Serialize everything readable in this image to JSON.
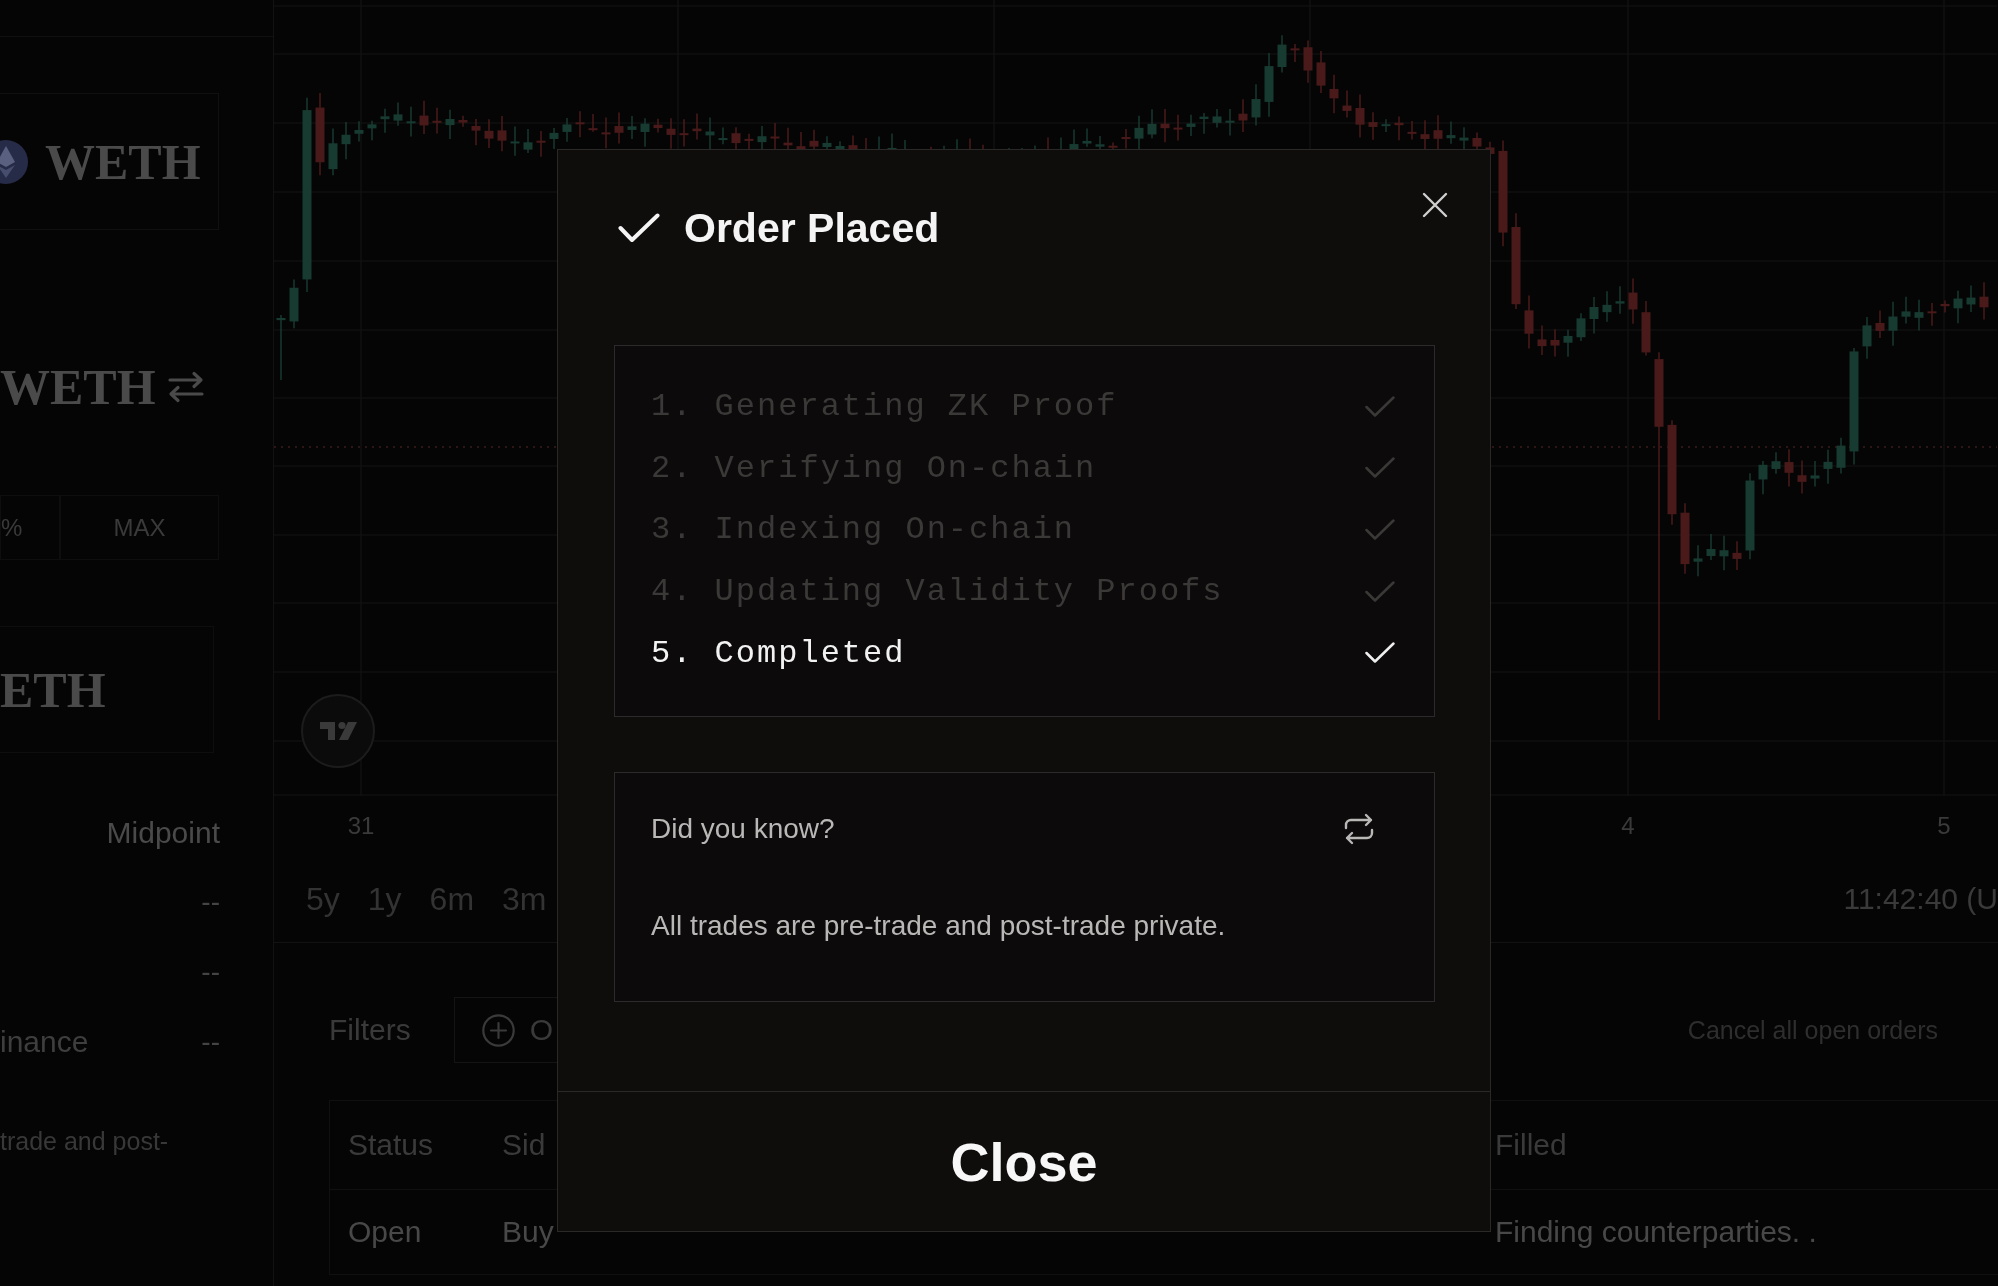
{
  "sidebar": {
    "token_card": {
      "symbol": "WETH"
    },
    "pair": {
      "symbol": "WETH"
    },
    "amount_buttons": [
      "%",
      "MAX"
    ],
    "receive_card": {
      "symbol": "ETH"
    },
    "stats": {
      "header": "Midpoint",
      "rows": [
        {
          "value": "--"
        },
        {
          "value": "--"
        },
        {
          "label": "inance",
          "value": "--"
        }
      ]
    },
    "note": "trade and post-"
  },
  "chart": {
    "x_labels": [
      "31",
      "4",
      "5"
    ],
    "timeframes": [
      "5y",
      "1y",
      "6m",
      "3m"
    ],
    "clock": "11:42:40 (U"
  },
  "orders": {
    "filters_label": "Filters",
    "filter_chip": "O",
    "cancel_all": "Cancel all open orders",
    "columns": [
      "Status",
      "Sid",
      "Filled"
    ],
    "rows": [
      [
        "Open",
        "Buy",
        "Finding counterparties. ."
      ]
    ]
  },
  "modal": {
    "title": "Order Placed",
    "steps": [
      {
        "label": "1. Generating ZK Proof",
        "done": true,
        "active": false
      },
      {
        "label": "2. Verifying On-chain",
        "done": true,
        "active": false
      },
      {
        "label": "3. Indexing On-chain",
        "done": true,
        "active": false
      },
      {
        "label": "4. Updating Validity Proofs",
        "done": true,
        "active": false
      },
      {
        "label": "5. Completed",
        "done": true,
        "active": true
      }
    ],
    "tip": {
      "heading": "Did you know?",
      "text": "All trades are pre-trade and post-trade private."
    },
    "close_button": "Close"
  }
}
